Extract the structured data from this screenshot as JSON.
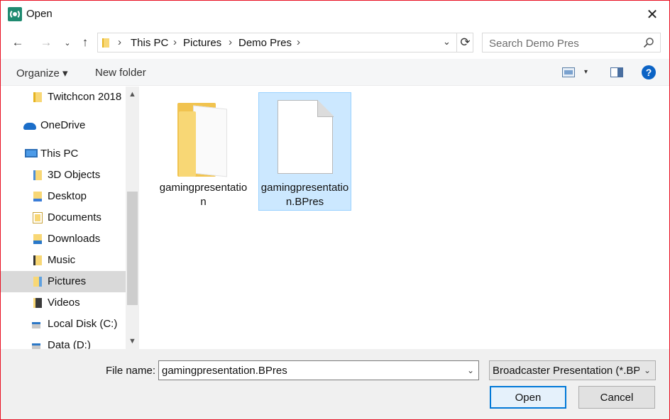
{
  "window": {
    "title": "Open",
    "close_glyph": "✕",
    "icon": "broadcaster-app-icon"
  },
  "nav": {
    "back": "←",
    "forward": "→",
    "recent": "⌄",
    "up": "↑"
  },
  "address": {
    "crumbs": [
      "This PC",
      "Pictures",
      "Demo Pres"
    ],
    "separator": "›",
    "dropdown": "⌄",
    "refresh": "⟳"
  },
  "search": {
    "placeholder": "Search Demo Pres"
  },
  "toolbar": {
    "organize_label": "Organize ▾",
    "new_folder_label": "New folder",
    "view_dropdown": "▾",
    "help_label": "?"
  },
  "sidebar": {
    "items": [
      {
        "label": "Twitchcon 2018",
        "icon": "folder-icon"
      },
      {
        "label": "OneDrive",
        "icon": "onedrive-icon"
      },
      {
        "label": "This PC",
        "icon": "computer-icon"
      },
      {
        "label": "3D Objects",
        "icon": "3d-objects-icon"
      },
      {
        "label": "Desktop",
        "icon": "desktop-icon"
      },
      {
        "label": "Documents",
        "icon": "documents-icon"
      },
      {
        "label": "Downloads",
        "icon": "downloads-icon"
      },
      {
        "label": "Music",
        "icon": "music-icon"
      },
      {
        "label": "Pictures",
        "icon": "pictures-icon",
        "selected": true
      },
      {
        "label": "Videos",
        "icon": "videos-icon"
      },
      {
        "label": "Local Disk (C:)",
        "icon": "disk-icon"
      },
      {
        "label": "Data (D:)",
        "icon": "disk-icon"
      }
    ],
    "scroll_up": "▲",
    "scroll_down": "▼"
  },
  "files": [
    {
      "name": "gamingpresentation",
      "kind": "folder",
      "selected": false
    },
    {
      "name": "gamingpresentation.BPres",
      "kind": "file",
      "selected": true
    }
  ],
  "bottom": {
    "file_name_label": "File name:",
    "file_name_value": "gamingpresentation.BPres",
    "file_name_dropdown": "⌄",
    "file_type_value": "Broadcaster Presentation (*.BPres)",
    "file_type_dropdown": "⌄",
    "open_label": "Open",
    "cancel_label": "Cancel"
  },
  "colors": {
    "accent": "#0078d7",
    "selection": "#cce8ff",
    "border": "#e81123"
  }
}
